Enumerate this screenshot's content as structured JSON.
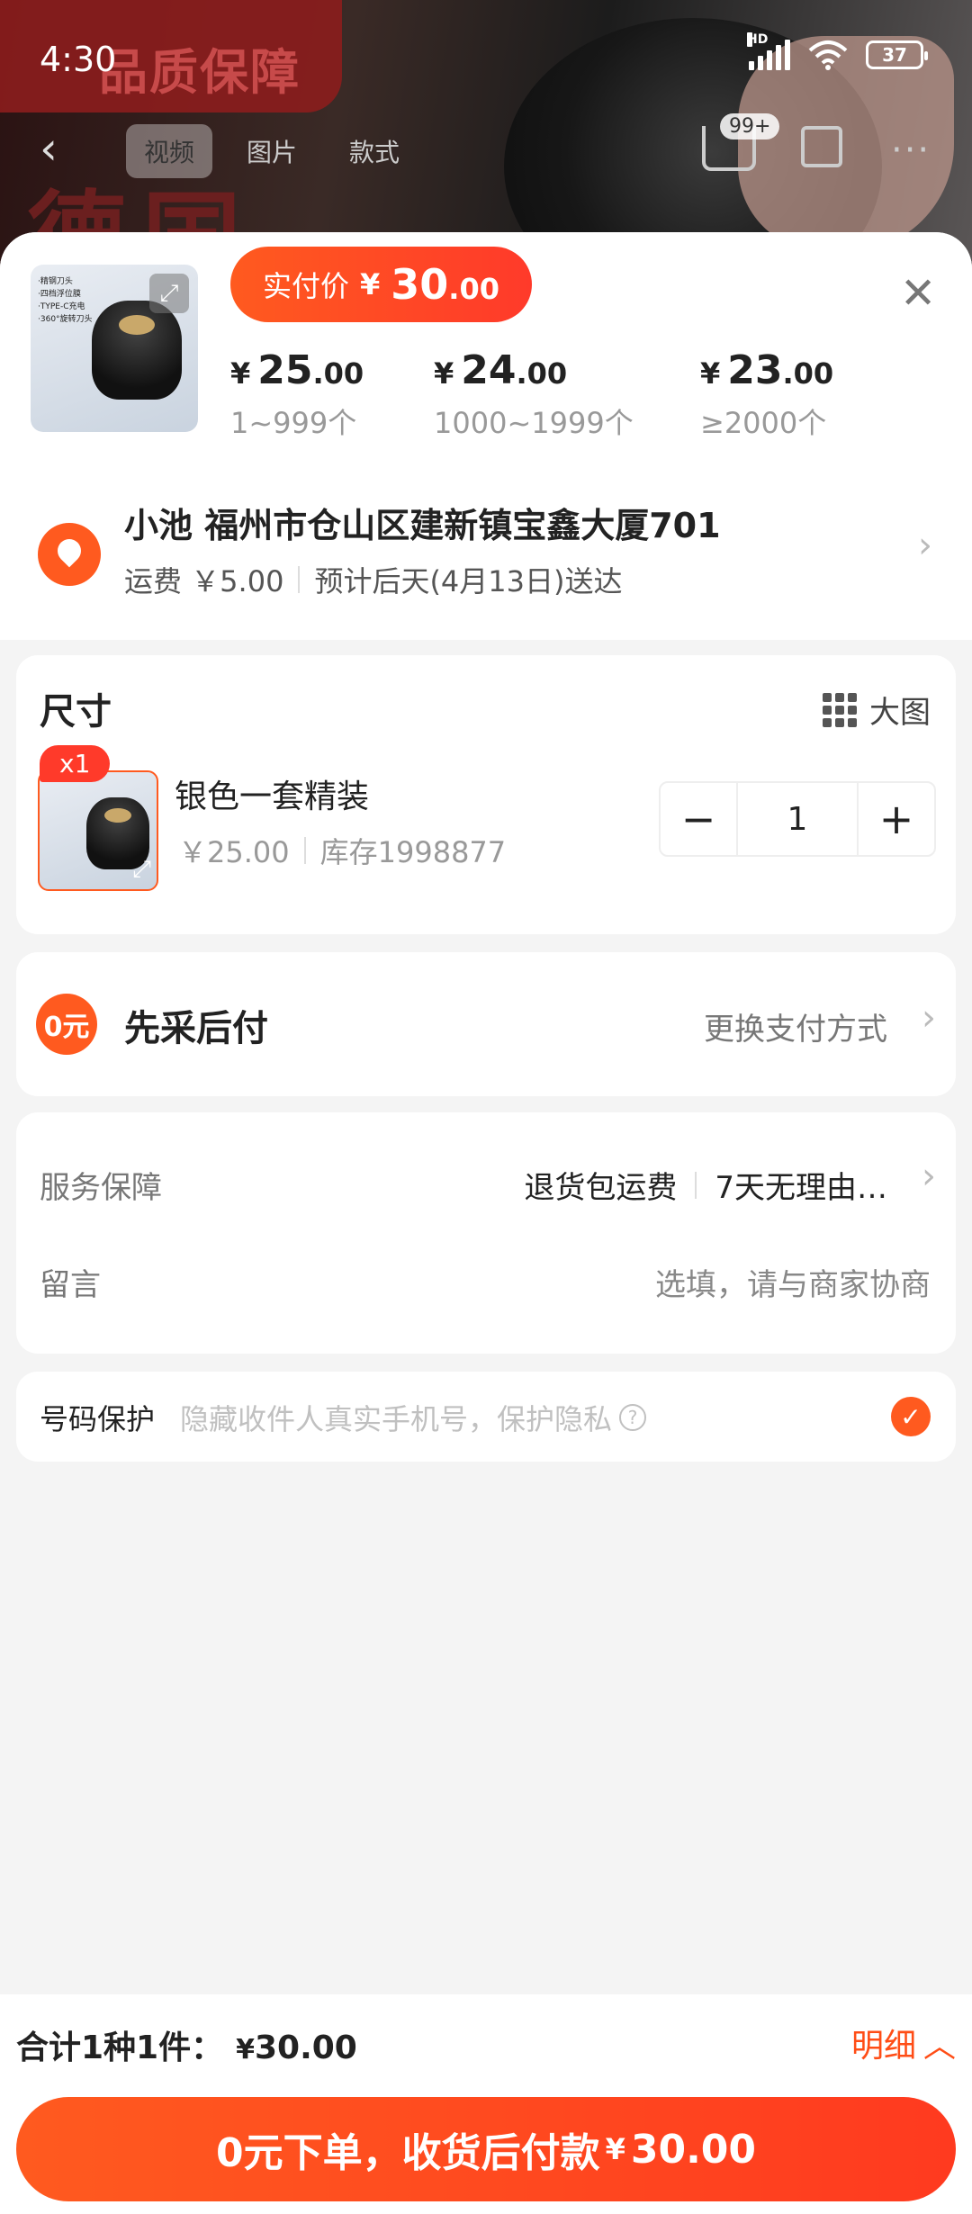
{
  "status_bar": {
    "time": "4:30",
    "network": "HD",
    "battery": "37"
  },
  "hero": {
    "brand_text": "品质保障",
    "title_text": "德国",
    "tabs": [
      {
        "label": "视频"
      },
      {
        "label": "图片"
      },
      {
        "label": "款式"
      }
    ],
    "cart_badge": "99+"
  },
  "product": {
    "thumb_lines": [
      "·精钢刀头",
      "·四档浮位膜",
      "·TYPE-C充电",
      "·360°旋转刀头"
    ],
    "actual_price": {
      "label": "实付价",
      "currency": "¥",
      "integer": "30",
      "decimal": ".00"
    },
    "tiers": [
      {
        "currency": "¥",
        "integer": "25",
        "decimal": ".00",
        "qty": "1~999个"
      },
      {
        "currency": "¥",
        "integer": "24",
        "decimal": ".00",
        "qty": "1000~1999个"
      },
      {
        "currency": "¥",
        "integer": "23",
        "decimal": ".00",
        "qty": "≥2000个"
      }
    ]
  },
  "address": {
    "title": "小池 福州市仓山区建新镇宝鑫大厦701",
    "shipping": "运费 ￥5.00",
    "eta": "预计后天(4月13日)送达"
  },
  "sku": {
    "section_title": "尺寸",
    "big_image_label": "大图",
    "badge": "x1",
    "name": "银色一套精装",
    "price": "￥25.00",
    "stock": "库存1998877",
    "quantity": "1",
    "minus": "−",
    "plus": "+"
  },
  "payment": {
    "icon_text": "0元",
    "label": "先采后付",
    "change_label": "更换支付方式"
  },
  "service": {
    "label": "服务保障",
    "values": [
      "退货包运费",
      "7天无理由…"
    ],
    "note_label": "留言",
    "note_placeholder": "选填，请与商家协商"
  },
  "phone_protect": {
    "label": "号码保护",
    "hint": "隐藏收件人真实手机号，保护隐私",
    "checked": true
  },
  "footer": {
    "total_label": "合计1种1件：",
    "total_currency": "¥",
    "total_amount": "30.00",
    "detail_label": "明细",
    "cta_label": "0元下单，收货后付款",
    "cta_currency": "¥",
    "cta_amount": "30.00"
  },
  "colors": {
    "accent": "#ff5a1f",
    "accent_dark": "#ff3a2a",
    "muted": "#999999"
  }
}
